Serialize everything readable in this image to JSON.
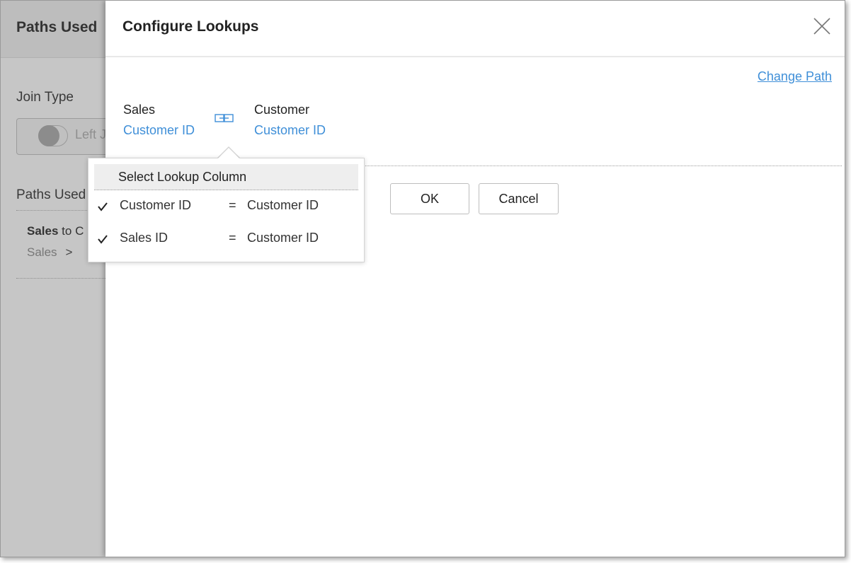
{
  "background": {
    "title": "Paths Used",
    "join_type_label": "Join Type",
    "toggle_label": "Left J",
    "paths_used_label": "Paths Used",
    "path_title_from": "Sales",
    "path_title_rest": "to C",
    "path_sub": "Sales",
    "path_sub_chevron": ">"
  },
  "dialog": {
    "title": "Configure Lookups",
    "change_path": "Change Path",
    "left_table": {
      "name": "Sales",
      "column": "Customer ID"
    },
    "right_table": {
      "name": "Customer",
      "column": "Customer ID"
    },
    "ok_label": "OK",
    "cancel_label": "Cancel"
  },
  "popover": {
    "header": "Select Lookup Column",
    "rows": [
      {
        "left": "Customer ID",
        "eq": "=",
        "right": "Customer ID",
        "checked": true
      },
      {
        "left": "Sales ID",
        "eq": "=",
        "right": "Customer ID",
        "checked": true
      }
    ]
  },
  "colors": {
    "link": "#3f8fd8",
    "overlay": "#c6c6c6"
  },
  "icons": {
    "close": "close-icon",
    "link": "link-columns-icon",
    "check": "checkmark-icon"
  }
}
